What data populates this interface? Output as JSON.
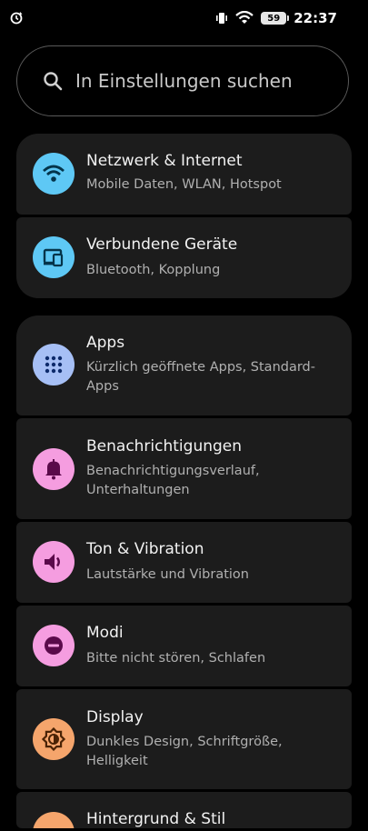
{
  "status_bar": {
    "time": "22:37",
    "battery_level": "59",
    "left_icon": "sync-clock-icon",
    "icons": [
      "vibrate-icon",
      "wifi-icon",
      "battery-icon"
    ]
  },
  "search": {
    "placeholder": "In Einstellungen suchen",
    "icon": "search-icon"
  },
  "groups": [
    {
      "items": [
        {
          "title": "Netzwerk & Internet",
          "subtitle": "Mobile Daten, WLAN, Hotspot",
          "icon": "wifi-icon",
          "icon_bg": "#5ec8f5"
        },
        {
          "title": "Verbundene Geräte",
          "subtitle": "Bluetooth, Kopplung",
          "icon": "devices-icon",
          "icon_bg": "#5ec8f5"
        }
      ]
    },
    {
      "items": [
        {
          "title": "Apps",
          "subtitle": "Kürzlich geöffnete Apps, Standard-Apps",
          "icon": "apps-grid-icon",
          "icon_bg": "#a6bff5"
        },
        {
          "title": "Benachrichtigungen",
          "subtitle": "Benachrichtigungsverlauf, Unterhaltungen",
          "icon": "bell-icon",
          "icon_bg": "#f59de0"
        },
        {
          "title": "Ton & Vibration",
          "subtitle": "Lautstärke und Vibration",
          "icon": "speaker-icon",
          "icon_bg": "#f59de0"
        },
        {
          "title": "Modi",
          "subtitle": "Bitte nicht stören, Schlafen",
          "icon": "do-not-disturb-icon",
          "icon_bg": "#f59de0"
        },
        {
          "title": "Display",
          "subtitle": "Dunkles Design, Schriftgröße, Helligkeit",
          "icon": "brightness-icon",
          "icon_bg": "#f5a56c"
        },
        {
          "title": "Hintergrund & Stil",
          "subtitle": "",
          "icon": "palette-icon",
          "icon_bg": "#f5a56c"
        }
      ]
    }
  ]
}
